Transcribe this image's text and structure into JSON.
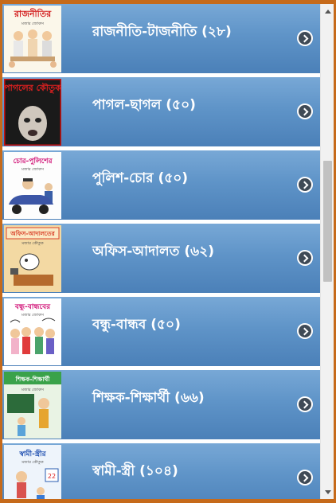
{
  "items": [
    {
      "label": "রাজনীতি-টাজনীতি (২৮)",
      "cover_title": "রাজনীতির",
      "cover_sub": "মজার জোকস"
    },
    {
      "label": "পাগল-ছাগল (৫০)",
      "cover_title": "পাগলের কৌতুক",
      "cover_sub": ""
    },
    {
      "label": "পুলিশ-চোর (৫০)",
      "cover_title": "চোর-পুলিশের",
      "cover_sub": "মজার জোকস"
    },
    {
      "label": "অফিস-আদালত (৬২)",
      "cover_title": "অফিস-আদালতের",
      "cover_sub": "মজার কৌতুক"
    },
    {
      "label": "বন্ধু-বান্ধব (৫০)",
      "cover_title": "বন্ধু-বান্ধবের",
      "cover_sub": "মজার জোকস"
    },
    {
      "label": "শিক্ষক-শিক্ষার্থী (৬৬)",
      "cover_title": "শিক্ষক-শিক্ষার্থী",
      "cover_sub": "মজার জোকস"
    },
    {
      "label": "স্বামী-স্ত্রী (১০৪)",
      "cover_title": "স্বামী-স্ত্রীর",
      "cover_sub": "মজার কৌতুক"
    }
  ],
  "icons": {
    "chevron": "chevron-right-circle-icon"
  },
  "colors": {
    "frame": "#c66a1a",
    "row_gradient_top": "#78a8d6",
    "row_gradient_bottom": "#4b80b8"
  }
}
